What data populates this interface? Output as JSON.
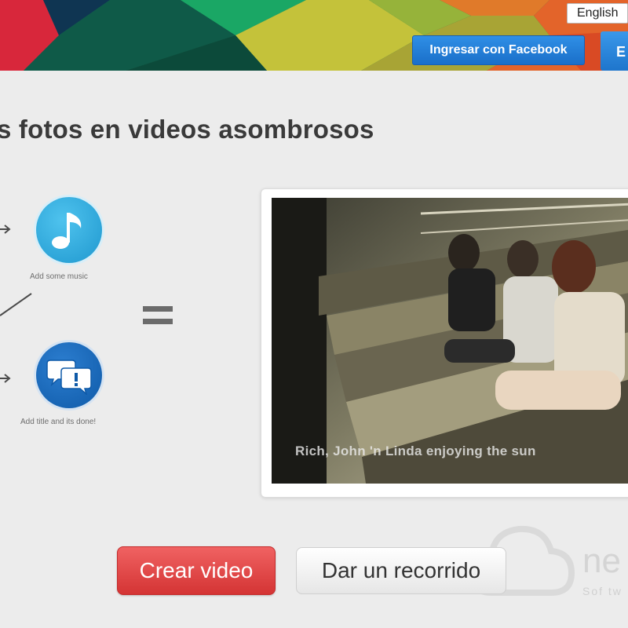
{
  "header": {
    "language": "English",
    "facebook_login_label": "Ingresar con Facebook",
    "second_button_label": "E"
  },
  "main": {
    "headline": "s fotos en videos asombrosos",
    "steps": [
      {
        "icon": "music-note-icon",
        "label": "Add some music"
      },
      {
        "icon": "chat-bubbles-icon",
        "label": "Add title and its done!"
      }
    ],
    "video": {
      "subtitle": "Rich, John 'n Linda enjoying the sun"
    }
  },
  "actions": {
    "create_label": "Crear video",
    "tour_label": "Dar un recorrido"
  },
  "brand": {
    "name": "ne",
    "tagline": "Sof tw"
  },
  "colors": {
    "facebook_blue": "#1a6fc9",
    "create_red": "#d43434",
    "music_icon_blue": "#1f98cf",
    "title_icon_blue": "#0f5aa8",
    "page_background": "#ececec"
  }
}
